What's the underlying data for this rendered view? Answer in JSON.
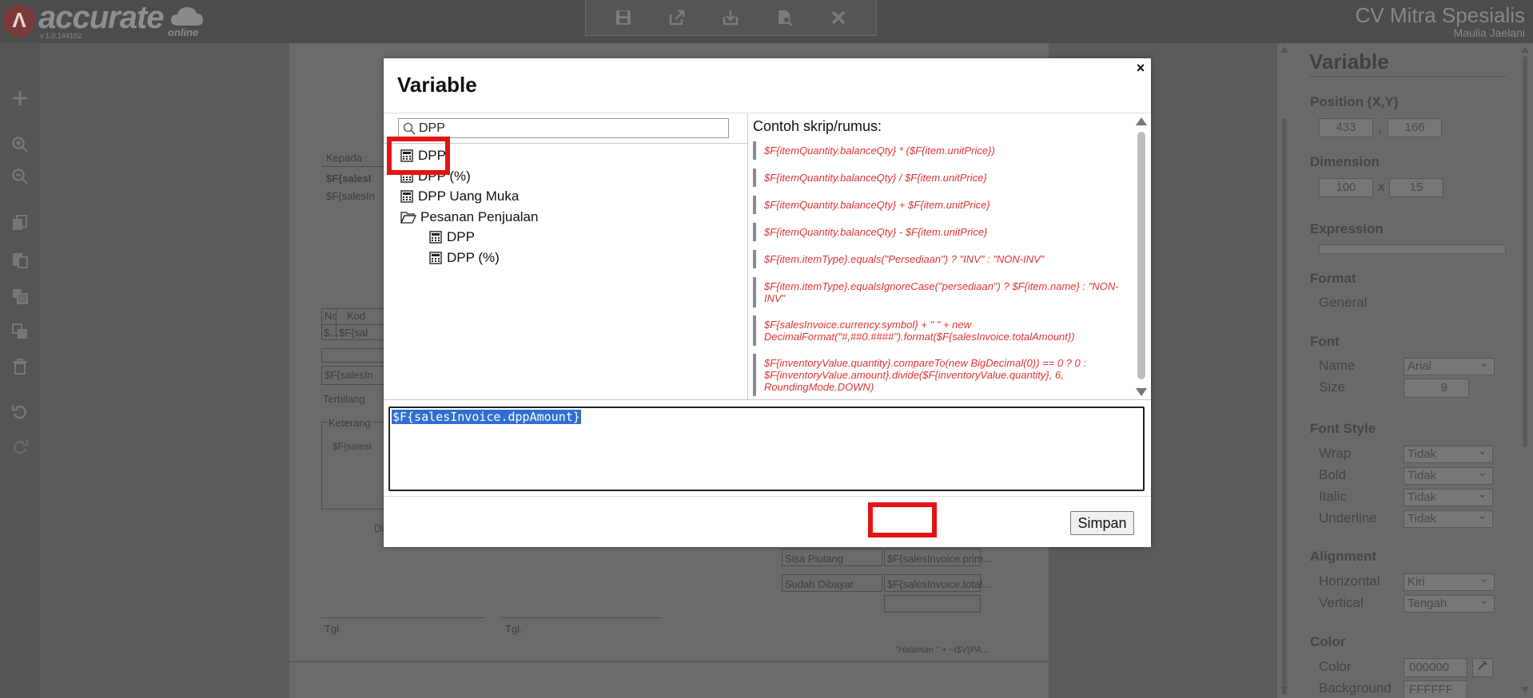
{
  "app": {
    "logo_text": "accurate",
    "logo_online": "online",
    "version": "v 1.0.1#4102",
    "company_name": "CV Mitra Spesialis",
    "user_name": "Maulia Jaelani"
  },
  "toolbar": {
    "icons": [
      "save-icon",
      "export-icon",
      "import-icon",
      "preview-icon",
      "close-icon"
    ]
  },
  "left_tools": {
    "icons": [
      "add-icon",
      "zoom-in-icon",
      "zoom-out-icon",
      "copy-icon",
      "paste-icon",
      "bring-front-icon",
      "send-back-icon",
      "delete-icon",
      "undo-icon",
      "redo-icon"
    ]
  },
  "paper": {
    "kepada": "Kepada :",
    "field1": "$F{salesI",
    "field2": "$F{salesIn",
    "col_no": "Nc",
    "col_kode": "Kod",
    "cell1": "$...",
    "cell2": "$F{sal",
    "field3": "$F{salesIn",
    "terbilang": "Terbilang",
    "keterangan": "Keterang",
    "field4": "$F{salesl",
    "di": "Di",
    "sisa_piutang": "Sisa Piutang",
    "sisa_piutang_val": "$F{salesInvoice.prim...",
    "sudah_dibayar": "Sudah Dibayar",
    "sudah_dibayar_val": "$F{salesInvoice.total...",
    "tgl1": "Tgl",
    "tgl2": "Tgl.",
    "halaman": "\"Halaman \" +  ~t$V{PA..."
  },
  "right_panel": {
    "title": "Variable",
    "position_label": "Position (X,Y)",
    "pos_x": "433",
    "pos_sep": ",",
    "pos_y": "166",
    "dimension_label": "Dimension",
    "dim_w": "100",
    "dim_sep": "x",
    "dim_h": "15",
    "expression_label": "Expression",
    "format_label": "Format",
    "format_value": "General",
    "font_label": "Font",
    "font_name_label": "Name",
    "font_name_value": "Arial",
    "font_size_label": "Size",
    "font_size_value": "9",
    "font_style_label": "Font Style",
    "wrap_label": "Wrap",
    "wrap_value": "Tidak",
    "bold_label": "Bold",
    "bold_value": "Tidak",
    "italic_label": "Italic",
    "italic_value": "Tidak",
    "underline_label": "Underline",
    "underline_value": "Tidak",
    "alignment_label": "Alignment",
    "horizontal_label": "Horizontal",
    "horizontal_value": "Kiri",
    "vertical_label": "Vertical",
    "vertical_value": "Tengah",
    "color_section_label": "Color",
    "color_label": "Color",
    "color_value": "000000",
    "background_label": "Background",
    "background_value": "FFFFFF"
  },
  "modal": {
    "title": "Variable",
    "close": "×",
    "search_value": "DPP",
    "search_placeholder": "",
    "tree": [
      {
        "label": "DPP",
        "type": "variable",
        "level": 0
      },
      {
        "label": "DPP (%)",
        "type": "variable",
        "level": 0
      },
      {
        "label": "DPP Uang Muka",
        "type": "variable",
        "level": 0
      },
      {
        "label": "Pesanan Penjualan",
        "type": "folder",
        "level": 0
      },
      {
        "label": "DPP",
        "type": "variable",
        "level": 1
      },
      {
        "label": "DPP (%)",
        "type": "variable",
        "level": 1
      }
    ],
    "examples_title": "Contoh skrip/rumus:",
    "examples": [
      "$F{itemQuantity.balanceQty} * ($F{item.unitPrice})",
      "$F{itemQuantity.balanceQty} / $F{item.unitPrice}",
      "$F{itemQuantity.balanceQty} + $F{item.unitPrice}",
      "$F{itemQuantity.balanceQty} - $F{item.unitPrice}",
      "$F{item.itemType}.equals(\"Persediaan\") ? \"INV\" : \"NON-INV\"",
      "$F{item.itemType}.equalsIgnoreCase(\"persediaan\") ? $F{item.name} : \"NON-INV\"",
      "$F{salesInvoice.currency.symbol} + \" \" + new DecimalFormat(\"#,##0.####\").format($F{salesInvoice.totalAmount})",
      "$F{inventoryValue.quantity}.compareTo(new BigDecimal(0)) == 0 ? 0 : $F{inventoryValue.amount}.divide($F{inventoryValue.quantity}, 6, RoundingMode.DOWN)"
    ],
    "expression": "$F{salesInvoice.dppAmount}",
    "save_label": "Simpan"
  },
  "colors": {
    "highlight": "#e51414",
    "example_text": "#dd3333",
    "selection": "#2f6fd1"
  }
}
